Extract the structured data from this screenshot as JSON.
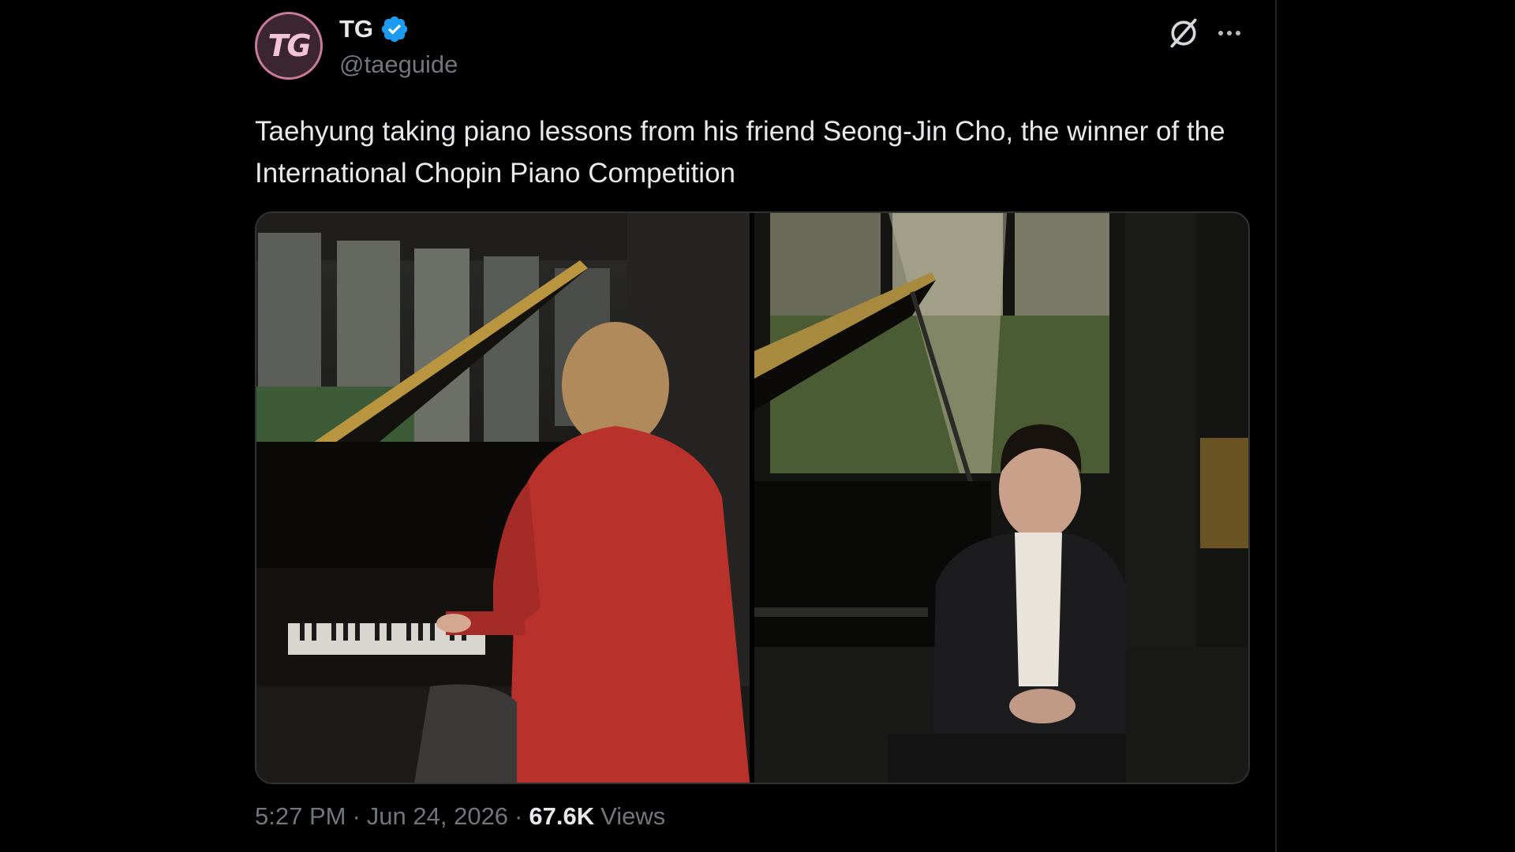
{
  "author": {
    "avatar_text": "TG",
    "display_name": "TG",
    "handle": "@taeguide",
    "verified": true
  },
  "tweet": {
    "text": "Taehyung taking piano lessons from his friend Seong-Jin Cho, the winner of the International Chopin Piano Competition"
  },
  "media": {
    "photos": [
      {
        "name": "photo-left",
        "subject": "person in red sweater playing grand piano"
      },
      {
        "name": "photo-right",
        "subject": "man seated in front of grand piano"
      }
    ]
  },
  "meta": {
    "time": "5:27 PM",
    "separator": "·",
    "date": "Jun 24, 2026",
    "views_count": "67.6K",
    "views_label": "Views"
  },
  "icons": {
    "grok": "grok-icon",
    "more": "more-icon",
    "verified": "verified-badge-icon"
  },
  "colors": {
    "background": "#000000",
    "text_primary": "#e7e9ea",
    "text_secondary": "#71767b",
    "verified_blue": "#1d9bf0"
  }
}
